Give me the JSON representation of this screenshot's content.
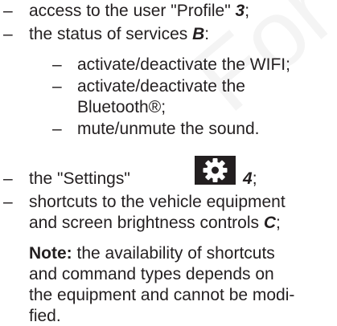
{
  "watermark": "For Pro",
  "items": [
    {
      "dash": "–",
      "text": "access to the user \"Profile\"",
      "ref": "3",
      "tail": ";"
    },
    {
      "dash": "–",
      "text": "the status of services",
      "ref": "B",
      "tail": ":"
    }
  ],
  "sub_items": [
    {
      "dash": "–",
      "text": "activate/deactivate the WIFI;"
    },
    {
      "dash": "–",
      "line1": "activate/deactivate the",
      "line2": "Bluetooth®;"
    },
    {
      "dash": "–",
      "text": "mute/unmute the sound."
    }
  ],
  "settings_item": {
    "dash": "–",
    "text": "the \"Settings\"",
    "icon": "gear-icon",
    "ref": "4",
    "tail": ";"
  },
  "shortcuts_item": {
    "dash": "–",
    "line1": "shortcuts to the vehicle equipment",
    "line2": "and screen brightness controls",
    "ref": "C",
    "tail": ";"
  },
  "note": {
    "label": "Note:",
    "line1": " the availability of shortcuts",
    "line2": "and command types depends on",
    "line3": "the equipment and cannot be modi-",
    "line4": "fied."
  }
}
